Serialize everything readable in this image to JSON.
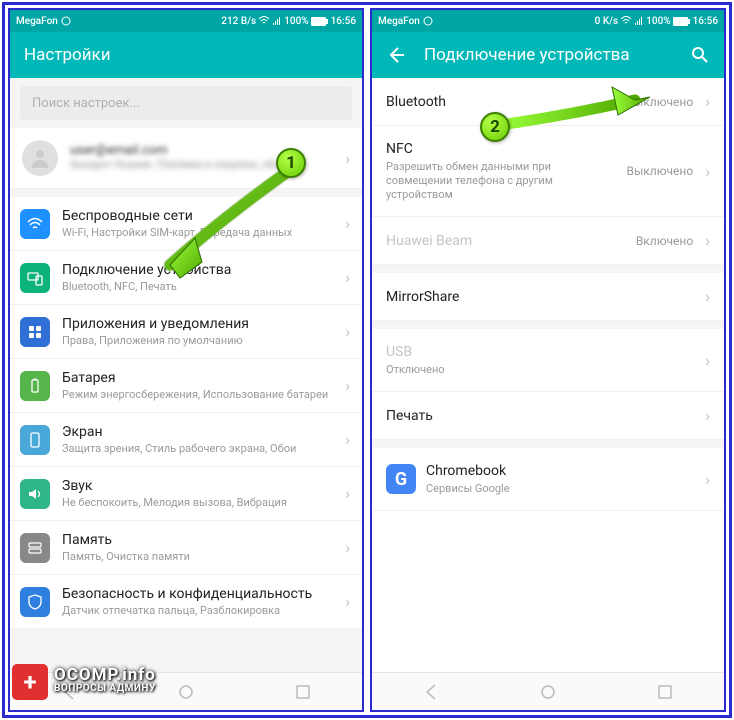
{
  "left": {
    "status": {
      "carrier": "MegaFon",
      "speed": "212 B/s",
      "battery": "100%",
      "time": "16:56"
    },
    "title": "Настройки",
    "search_placeholder": "Поиск настроек...",
    "account": {
      "line1": "user@email.com",
      "line2": "Аккаунт Huawei. Платежи и покупки, облако"
    },
    "items": [
      {
        "title": "Беспроводные сети",
        "sub": "Wi-Fi, Настройки SIM-карт, Передача данных",
        "color": "#1e90ff"
      },
      {
        "title": "Подключение устройства",
        "sub": "Bluetooth, NFC, Печать",
        "color": "#0bb37a"
      },
      {
        "title": "Приложения и уведомления",
        "sub": "Права, Приложения по умолчанию",
        "color": "#2f6fd6"
      },
      {
        "title": "Батарея",
        "sub": "Режим энергосбережения, Использование батареи",
        "color": "#56b54a"
      },
      {
        "title": "Экран",
        "sub": "Защита зрения, Стиль рабочего экрана, Обои",
        "color": "#4aa8d8"
      },
      {
        "title": "Звук",
        "sub": "Не беспокоить, Мелодия вызова, Вибрация",
        "color": "#2eb58a"
      },
      {
        "title": "Память",
        "sub": "Память, Очистка памяти",
        "color": "#888"
      },
      {
        "title": "Безопасность и конфиденциальность",
        "sub": "Датчик отпечатка пальца, Разблокировка",
        "color": "#2f7fdf"
      }
    ]
  },
  "right": {
    "status": {
      "carrier": "MegaFon",
      "speed": "0 K/s",
      "battery": "100%",
      "time": "16:56"
    },
    "title": "Подключение устройства",
    "items": [
      {
        "title": "Bluetooth",
        "value": "Выключено"
      },
      {
        "title": "NFC",
        "sub": "Разрешить обмен данными при совмещении телефона с другим устройством",
        "value": "Выключено"
      },
      {
        "title": "Huawei Beam",
        "value": "Включено",
        "disabled": true
      },
      {
        "title": "MirrorShare",
        "gapBefore": true
      },
      {
        "title": "USB",
        "sub": "Отключено",
        "disabled": true,
        "gapBefore": true
      },
      {
        "title": "Печать"
      },
      {
        "title": "Chromebook",
        "sub": "Сервисы Google",
        "icon": "G",
        "gapBefore": true
      }
    ]
  },
  "markers": {
    "m1": "1",
    "m2": "2"
  },
  "watermark": {
    "icon": "+",
    "main": "OCOMP.info",
    "sub": "ВОПРОСЫ АДМИНУ"
  }
}
